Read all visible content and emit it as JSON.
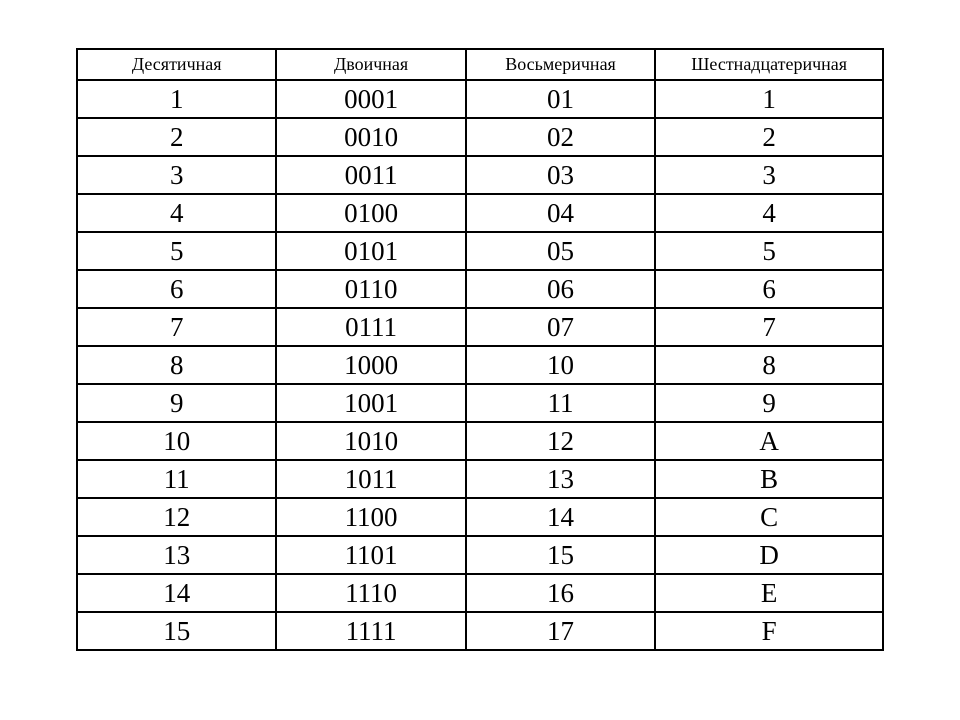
{
  "table": {
    "headers": [
      "Десятичная",
      "Двоичная",
      "Восьмеричная",
      "Шестнадцатеричная"
    ],
    "rows": [
      [
        "1",
        "0001",
        "01",
        "1"
      ],
      [
        "2",
        "0010",
        "02",
        "2"
      ],
      [
        "3",
        "0011",
        "03",
        "3"
      ],
      [
        "4",
        "0100",
        "04",
        "4"
      ],
      [
        "5",
        "0101",
        "05",
        "5"
      ],
      [
        "6",
        "0110",
        "06",
        "6"
      ],
      [
        "7",
        "0111",
        "07",
        "7"
      ],
      [
        "8",
        "1000",
        "10",
        "8"
      ],
      [
        "9",
        "1001",
        "11",
        "9"
      ],
      [
        "10",
        "1010",
        "12",
        "A"
      ],
      [
        "11",
        "1011",
        "13",
        "B"
      ],
      [
        "12",
        "1100",
        "14",
        "C"
      ],
      [
        "13",
        "1101",
        "15",
        "D"
      ],
      [
        "14",
        "1110",
        "16",
        "E"
      ],
      [
        "15",
        "1111",
        "17",
        "F"
      ]
    ]
  }
}
